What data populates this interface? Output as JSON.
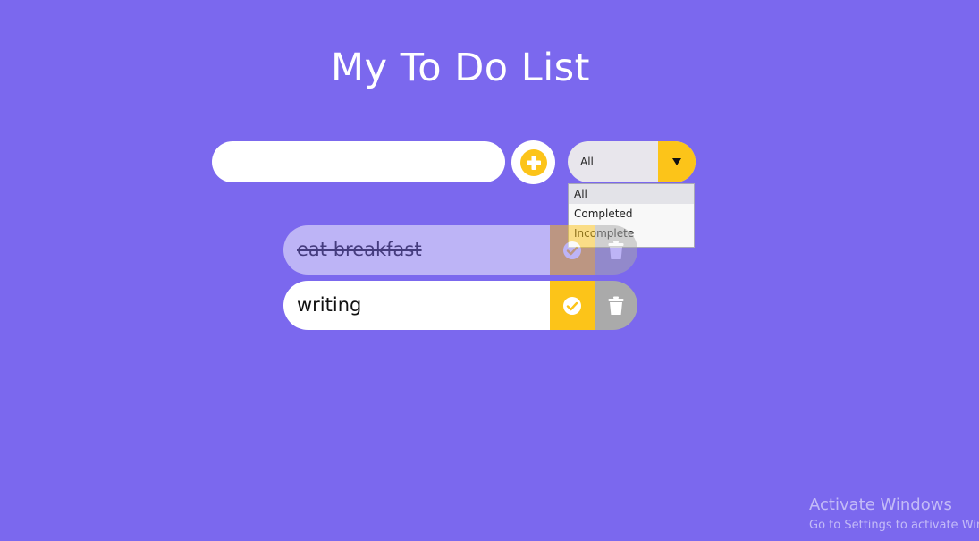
{
  "header": {
    "title": "My To Do List"
  },
  "form": {
    "input_value": "",
    "add_icon": "plus-circle-icon",
    "filter_value": "All",
    "filter_arrow_icon": "triangle-down-icon",
    "filter_options": [
      "All",
      "Completed",
      "Incomplete"
    ]
  },
  "todos": [
    {
      "text": "eat breakfast",
      "completed": true
    },
    {
      "text": "writing",
      "completed": false
    }
  ],
  "icons": {
    "check": "check-circle-icon",
    "delete": "trash-icon"
  },
  "colors": {
    "background": "#7b68ee",
    "accent": "#fcc419",
    "delete": "#aaaaaa"
  },
  "watermark": {
    "line1": "Activate Windows",
    "line2": "Go to Settings to activate Windows."
  }
}
